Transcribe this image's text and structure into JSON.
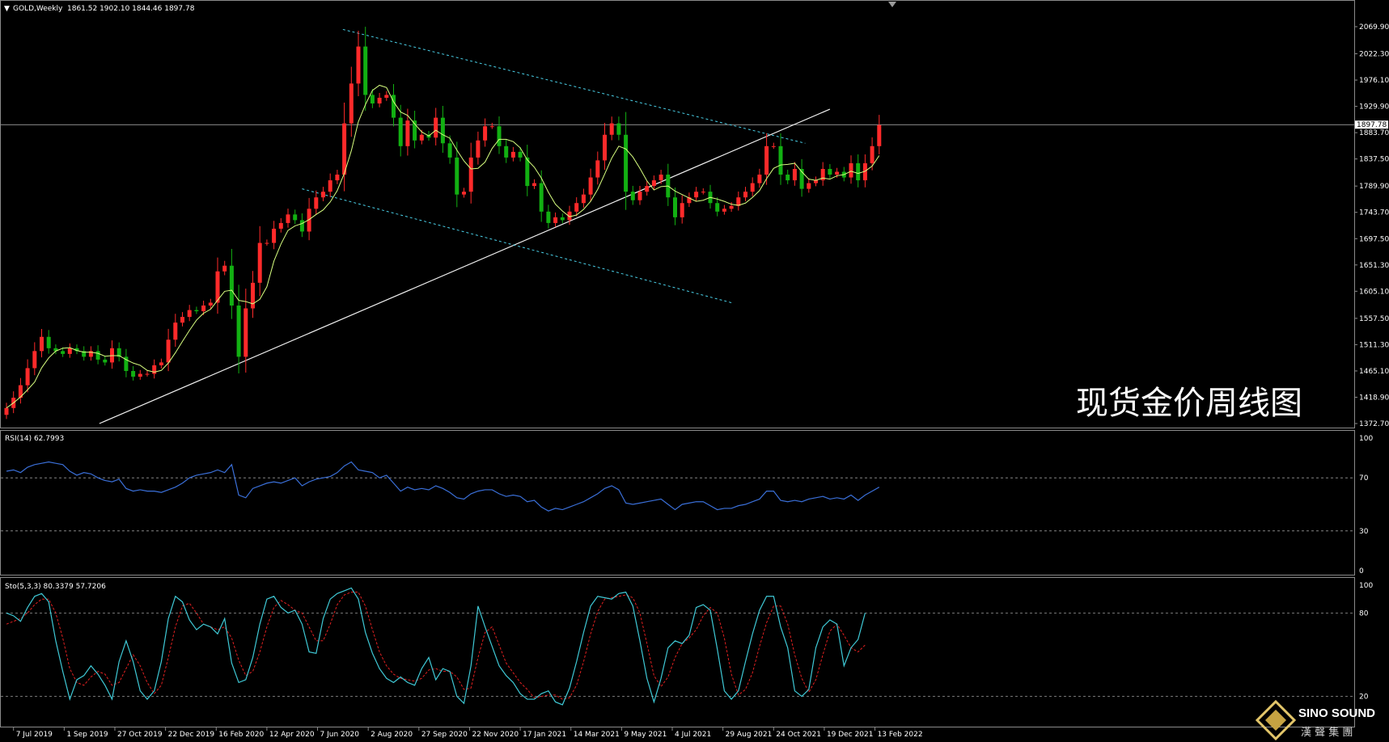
{
  "header": {
    "symbol": "GOLD,Weekly",
    "ohlc": "1861.52 1902.10 1844.46 1897.78"
  },
  "watermark_title": "现货金价周线图",
  "brand": {
    "name": "SINO SOUND",
    "sub": "漢 聲 集 團"
  },
  "rsi_panel": {
    "label": "RSI(14) 62.7993",
    "levels": [
      "100",
      "70",
      "30",
      "0"
    ]
  },
  "sto_panel": {
    "label": "Sto(5,3,3) 80.3379 57.7206",
    "levels": [
      "100",
      "80",
      "20"
    ]
  },
  "colors": {
    "bull": "#ff2a2a",
    "bear": "#12b012",
    "ma": "#d8ff80",
    "trend": "#f0f0f0",
    "channel": "#4ad0e8",
    "rsi": "#3a6fd8",
    "sto_main": "#3fc9d6",
    "sto_signal": "#e02020"
  },
  "chart_data": [
    {
      "type": "candlestick",
      "title": "GOLD,Weekly",
      "y_ticks": [
        "2069.90",
        "2022.30",
        "1976.10",
        "1929.90",
        "1883.70",
        "1837.50",
        "1789.90",
        "1743.70",
        "1697.50",
        "1651.30",
        "1605.10",
        "1557.50",
        "1511.30",
        "1465.10",
        "1418.90",
        "1372.70"
      ],
      "x_ticks": [
        "7 Jul 2019",
        "1 Sep 2019",
        "27 Oct 2019",
        "22 Dec 2019",
        "16 Feb 2020",
        "12 Apr 2020",
        "7 Jun 2020",
        "2 Aug 2020",
        "27 Sep 2020",
        "22 Nov 2020",
        "17 Jan 2021",
        "14 Mar 2021",
        "9 May 2021",
        "4 Jul 2021",
        "29 Aug 2021",
        "24 Oct 2021",
        "19 Dec 2021",
        "13 Feb 2022"
      ],
      "ylim": [
        1372.7,
        2069.9
      ],
      "current_price": "1897.78",
      "close": [
        1400,
        1418,
        1440,
        1470,
        1500,
        1525,
        1505,
        1500,
        1495,
        1505,
        1500,
        1490,
        1500,
        1485,
        1480,
        1505,
        1490,
        1465,
        1455,
        1460,
        1460,
        1475,
        1480,
        1520,
        1550,
        1560,
        1572,
        1570,
        1580,
        1585,
        1640,
        1650,
        1580,
        1490,
        1575,
        1620,
        1690,
        1690,
        1715,
        1725,
        1740,
        1730,
        1710,
        1750,
        1770,
        1780,
        1800,
        1810,
        1900,
        1970,
        2035,
        1950,
        1935,
        1945,
        1950,
        1910,
        1860,
        1905,
        1870,
        1880,
        1875,
        1910,
        1865,
        1840,
        1775,
        1780,
        1840,
        1870,
        1895,
        1895,
        1860,
        1840,
        1850,
        1840,
        1790,
        1795,
        1745,
        1725,
        1735,
        1730,
        1745,
        1760,
        1775,
        1805,
        1835,
        1880,
        1900,
        1880,
        1780,
        1765,
        1780,
        1790,
        1800,
        1810,
        1770,
        1735,
        1760,
        1770,
        1780,
        1780,
        1760,
        1745,
        1750,
        1755,
        1770,
        1780,
        1795,
        1810,
        1860,
        1860,
        1810,
        1800,
        1820,
        1785,
        1795,
        1800,
        1820,
        1810,
        1815,
        1805,
        1830,
        1800,
        1830,
        1860,
        1897
      ]
    },
    {
      "type": "line",
      "title": "RSI(14) 62.7993",
      "ylim": [
        0,
        100
      ],
      "values": [
        75,
        76,
        74,
        78,
        80,
        81,
        82,
        81,
        80,
        75,
        72,
        74,
        73,
        70,
        68,
        67,
        69,
        62,
        60,
        61,
        60,
        60,
        59,
        61,
        63,
        66,
        70,
        72,
        73,
        74,
        76,
        74,
        80,
        57,
        55,
        62,
        64,
        66,
        67,
        66,
        68,
        70,
        64,
        67,
        69,
        70,
        71,
        74,
        79,
        82,
        76,
        75,
        74,
        70,
        72,
        66,
        60,
        63,
        61,
        62,
        61,
        64,
        62,
        59,
        55,
        54,
        58,
        60,
        61,
        61,
        58,
        56,
        57,
        56,
        52,
        53,
        48,
        45,
        47,
        46,
        48,
        50,
        52,
        55,
        58,
        62,
        64,
        61,
        51,
        50,
        51,
        52,
        53,
        54,
        50,
        46,
        50,
        51,
        52,
        52,
        49,
        46,
        47,
        47,
        49,
        50,
        52,
        54,
        60,
        60,
        53,
        52,
        53,
        52,
        54,
        55,
        56,
        54,
        55,
        54,
        57,
        53,
        57,
        60,
        63
      ]
    },
    {
      "type": "line",
      "title": "Sto(5,3,3) 80.3379 57.7206",
      "ylim": [
        0,
        100
      ],
      "series": [
        {
          "name": "main",
          "values": [
            80,
            78,
            74,
            84,
            92,
            94,
            88,
            60,
            38,
            18,
            32,
            35,
            42,
            36,
            28,
            18,
            45,
            60,
            45,
            24,
            18,
            24,
            45,
            76,
            92,
            88,
            75,
            68,
            72,
            70,
            65,
            76,
            44,
            30,
            32,
            48,
            72,
            90,
            92,
            84,
            80,
            82,
            72,
            52,
            51,
            76,
            90,
            94,
            96,
            98,
            90,
            66,
            51,
            40,
            33,
            30,
            34,
            30,
            28,
            40,
            48,
            32,
            40,
            38,
            20,
            15,
            42,
            85,
            70,
            56,
            42,
            35,
            30,
            22,
            18,
            18,
            22,
            24,
            16,
            14,
            26,
            45,
            66,
            85,
            92,
            91,
            90,
            94,
            95,
            85,
            60,
            33,
            16,
            33,
            55,
            60,
            58,
            64,
            84,
            86,
            82,
            54,
            24,
            18,
            24,
            45,
            65,
            82,
            92,
            92,
            70,
            55,
            24,
            20,
            25,
            55,
            70,
            75,
            72,
            42,
            55,
            61,
            80
          ]
        },
        {
          "name": "signal",
          "values": [
            72,
            74,
            76,
            80,
            86,
            90,
            90,
            80,
            62,
            40,
            30,
            28,
            34,
            38,
            36,
            28,
            30,
            40,
            50,
            42,
            30,
            22,
            28,
            48,
            70,
            85,
            87,
            80,
            72,
            70,
            68,
            70,
            62,
            46,
            35,
            38,
            52,
            70,
            84,
            89,
            86,
            82,
            80,
            70,
            60,
            60,
            72,
            86,
            93,
            95,
            95,
            85,
            68,
            52,
            42,
            36,
            33,
            32,
            31,
            33,
            39,
            40,
            38,
            38,
            34,
            25,
            26,
            48,
            66,
            70,
            57,
            44,
            37,
            30,
            25,
            19,
            20,
            21,
            21,
            18,
            19,
            28,
            45,
            65,
            81,
            90,
            91,
            92,
            93,
            91,
            80,
            58,
            35,
            27,
            34,
            48,
            58,
            62,
            68,
            78,
            84,
            80,
            62,
            36,
            21,
            25,
            37,
            56,
            73,
            85,
            85,
            72,
            50,
            33,
            23,
            32,
            50,
            67,
            72,
            64,
            55,
            52,
            57
          ]
        }
      ]
    }
  ]
}
